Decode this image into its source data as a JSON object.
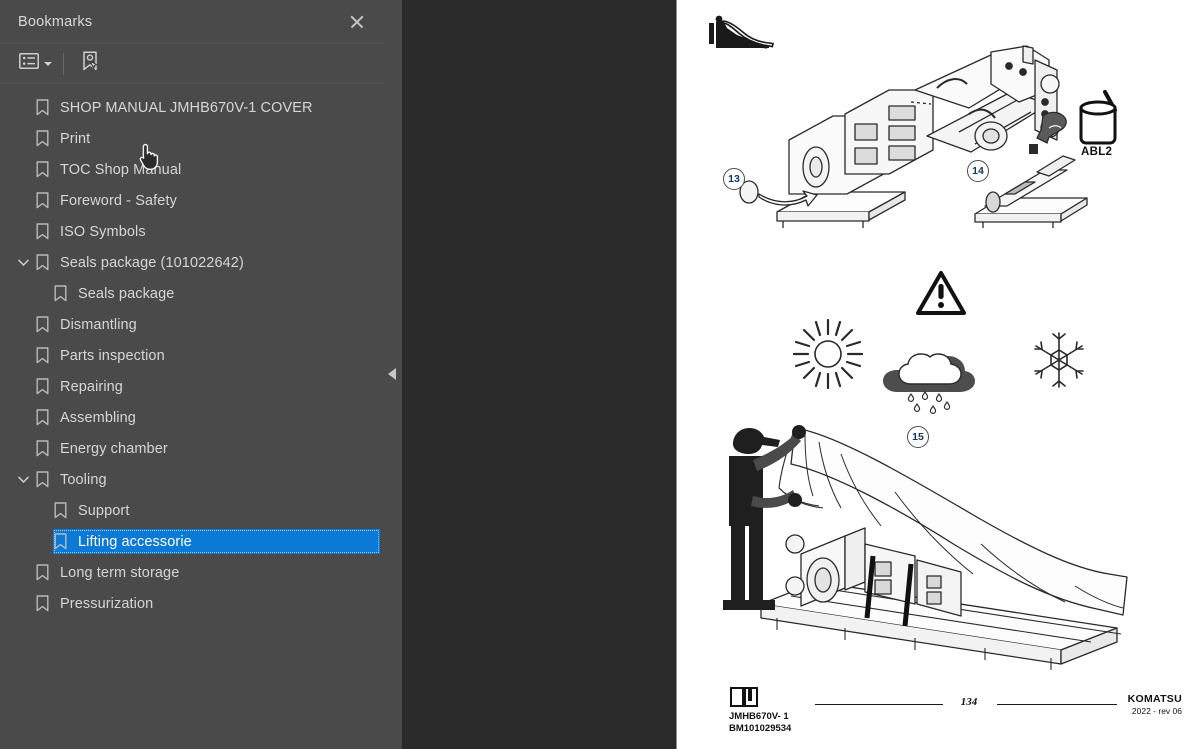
{
  "panel": {
    "title": "Bookmarks",
    "close_icon": "close-icon",
    "toolbar": {
      "options_icon": "list-options-icon",
      "options_caret": "chevron-down-icon",
      "new_bookmark_icon": "bookmark-pointer-icon"
    },
    "collapse_icon": "collapse-left-icon",
    "cursor_icon": "hand-pointer-cursor"
  },
  "bookmarks": [
    {
      "label": "SHOP MANUAL JMHB670V-1 COVER",
      "level": 0,
      "expandable": false,
      "expanded": false,
      "selected": false
    },
    {
      "label": "Print",
      "level": 0,
      "expandable": false,
      "expanded": false,
      "selected": false
    },
    {
      "label": "TOC Shop Manual",
      "level": 0,
      "expandable": false,
      "expanded": false,
      "selected": false
    },
    {
      "label": "Foreword - Safety",
      "level": 0,
      "expandable": false,
      "expanded": false,
      "selected": false
    },
    {
      "label": "ISO Symbols",
      "level": 0,
      "expandable": false,
      "expanded": false,
      "selected": false
    },
    {
      "label": "Seals package (101022642)",
      "level": 0,
      "expandable": true,
      "expanded": true,
      "selected": false
    },
    {
      "label": "Seals package",
      "level": 1,
      "expandable": false,
      "expanded": false,
      "selected": false
    },
    {
      "label": "Dismantling",
      "level": 0,
      "expandable": false,
      "expanded": false,
      "selected": false
    },
    {
      "label": "Parts inspection",
      "level": 0,
      "expandable": false,
      "expanded": false,
      "selected": false
    },
    {
      "label": "Repairing",
      "level": 0,
      "expandable": false,
      "expanded": false,
      "selected": false
    },
    {
      "label": "Assembling",
      "level": 0,
      "expandable": false,
      "expanded": false,
      "selected": false
    },
    {
      "label": "Energy chamber",
      "level": 0,
      "expandable": false,
      "expanded": false,
      "selected": false
    },
    {
      "label": "Tooling",
      "level": 0,
      "expandable": true,
      "expanded": true,
      "selected": false
    },
    {
      "label": "Support",
      "level": 1,
      "expandable": false,
      "expanded": false,
      "selected": false
    },
    {
      "label": "Lifting accessorie",
      "level": 1,
      "expandable": false,
      "expanded": false,
      "selected": true
    },
    {
      "label": "Long term storage",
      "level": 0,
      "expandable": false,
      "expanded": false,
      "selected": false
    },
    {
      "label": "Pressurization",
      "level": 0,
      "expandable": false,
      "expanded": false,
      "selected": false
    }
  ],
  "document_page": {
    "corner_pictogram": "covering-equipment-pictogram",
    "steps": [
      {
        "number": "13",
        "icon": "step-marker-13"
      },
      {
        "number": "14",
        "icon": "step-marker-14"
      },
      {
        "number": "15",
        "icon": "step-marker-15"
      }
    ],
    "grease_label": "ABL2",
    "symbols": [
      {
        "name": "warning-triangle-icon"
      },
      {
        "name": "sun-icon"
      },
      {
        "name": "rain-cloud-icon"
      },
      {
        "name": "snowflake-icon"
      }
    ],
    "footer": {
      "model_line1": "JMHB670V- 1",
      "model_line2": "BM101029534",
      "page_number": "134",
      "brand": "KOMATSU",
      "revision": "2022 -  rev 06",
      "manual_icon": "manual-book-icon"
    }
  },
  "colors": {
    "sidebar_bg": "#4a4a4a",
    "viewer_bg": "#2a2a2a",
    "selection_blue": "#0b7ad6",
    "page_white": "#ffffff",
    "text": "#d6d6d6"
  }
}
